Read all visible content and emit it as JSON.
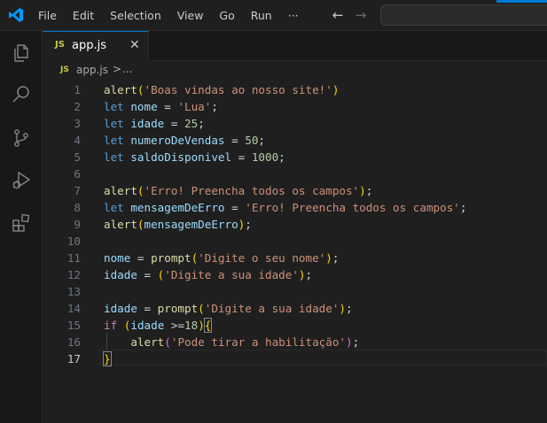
{
  "menu": [
    "File",
    "Edit",
    "Selection",
    "View",
    "Go",
    "Run",
    "···"
  ],
  "nav": {
    "back": "←",
    "forward": "→"
  },
  "activity_icons": [
    "explorer-icon",
    "search-icon",
    "source-control-icon",
    "run-debug-icon",
    "extensions-icon"
  ],
  "tab": {
    "icon": "JS",
    "name": "app.js",
    "close": "✕"
  },
  "breadcrumb": {
    "icon": "JS",
    "file": "app.js",
    "sep": ">",
    "more": "..."
  },
  "colors": {
    "accent": "#0078d4",
    "editor_bg": "#1f1f1f",
    "function": "#dcdcaa",
    "string": "#ce9178",
    "keyword": "#569cd6",
    "variable": "#9cdcfe",
    "number": "#b5cea8"
  },
  "active_line": 17,
  "lines": [
    [
      {
        "t": "fn",
        "v": "alert"
      },
      {
        "t": "br1",
        "v": "("
      },
      {
        "t": "str",
        "v": "'Boas vindas ao nosso site!'"
      },
      {
        "t": "br1",
        "v": ")"
      }
    ],
    [
      {
        "t": "kw",
        "v": "let"
      },
      {
        "t": "op",
        "v": " "
      },
      {
        "t": "var",
        "v": "nome"
      },
      {
        "t": "op",
        "v": " = "
      },
      {
        "t": "str",
        "v": "'Lua'"
      },
      {
        "t": "op",
        "v": ";"
      }
    ],
    [
      {
        "t": "kw",
        "v": "let"
      },
      {
        "t": "op",
        "v": " "
      },
      {
        "t": "var",
        "v": "idade"
      },
      {
        "t": "op",
        "v": " = "
      },
      {
        "t": "num",
        "v": "25"
      },
      {
        "t": "op",
        "v": ";"
      }
    ],
    [
      {
        "t": "kw",
        "v": "let"
      },
      {
        "t": "op",
        "v": " "
      },
      {
        "t": "var",
        "v": "numeroDeVendas"
      },
      {
        "t": "op",
        "v": " = "
      },
      {
        "t": "num",
        "v": "50"
      },
      {
        "t": "op",
        "v": ";"
      }
    ],
    [
      {
        "t": "kw",
        "v": "let"
      },
      {
        "t": "op",
        "v": " "
      },
      {
        "t": "var",
        "v": "saldoDisponivel"
      },
      {
        "t": "op",
        "v": " = "
      },
      {
        "t": "num",
        "v": "1000"
      },
      {
        "t": "op",
        "v": ";"
      }
    ],
    [],
    [
      {
        "t": "fn",
        "v": "alert"
      },
      {
        "t": "br1",
        "v": "("
      },
      {
        "t": "str",
        "v": "'Erro! Preencha todos os campos'"
      },
      {
        "t": "br1",
        "v": ")"
      },
      {
        "t": "op",
        "v": ";"
      }
    ],
    [
      {
        "t": "kw",
        "v": "let"
      },
      {
        "t": "op",
        "v": " "
      },
      {
        "t": "var",
        "v": "mensagemDeErro"
      },
      {
        "t": "op",
        "v": " = "
      },
      {
        "t": "str",
        "v": "'Erro! Preencha todos os campos'"
      },
      {
        "t": "op",
        "v": ";"
      }
    ],
    [
      {
        "t": "fn",
        "v": "alert"
      },
      {
        "t": "br1",
        "v": "("
      },
      {
        "t": "var",
        "v": "mensagemDeErro"
      },
      {
        "t": "br1",
        "v": ")"
      },
      {
        "t": "op",
        "v": ";"
      }
    ],
    [],
    [
      {
        "t": "var",
        "v": "nome"
      },
      {
        "t": "op",
        "v": " = "
      },
      {
        "t": "fn",
        "v": "prompt"
      },
      {
        "t": "br1",
        "v": "("
      },
      {
        "t": "str",
        "v": "'Digite o seu nome'"
      },
      {
        "t": "br1",
        "v": ")"
      },
      {
        "t": "op",
        "v": ";"
      }
    ],
    [
      {
        "t": "var",
        "v": "idade"
      },
      {
        "t": "op",
        "v": " = "
      },
      {
        "t": "br1",
        "v": "("
      },
      {
        "t": "str",
        "v": "'Digite a sua idade'"
      },
      {
        "t": "br1",
        "v": ")"
      },
      {
        "t": "op",
        "v": ";"
      }
    ],
    [],
    [
      {
        "t": "var",
        "v": "idade"
      },
      {
        "t": "op",
        "v": " = "
      },
      {
        "t": "fn",
        "v": "prompt"
      },
      {
        "t": "br1",
        "v": "("
      },
      {
        "t": "str",
        "v": "'Digite a sua idade'"
      },
      {
        "t": "br1",
        "v": ")"
      },
      {
        "t": "op",
        "v": ";"
      }
    ],
    [
      {
        "t": "ctl",
        "v": "if"
      },
      {
        "t": "op",
        "v": " "
      },
      {
        "t": "br1",
        "v": "("
      },
      {
        "t": "var",
        "v": "idade"
      },
      {
        "t": "op",
        "v": " >="
      },
      {
        "t": "num",
        "v": "18"
      },
      {
        "t": "br1",
        "v": ")"
      },
      {
        "t": "br1",
        "v": "{"
      }
    ],
    [
      {
        "t": "op",
        "v": "    "
      },
      {
        "t": "fn",
        "v": "alert"
      },
      {
        "t": "br2",
        "v": "("
      },
      {
        "t": "str",
        "v": "'Pode tirar a habilitação'"
      },
      {
        "t": "br2",
        "v": ")"
      },
      {
        "t": "op",
        "v": ";"
      }
    ],
    [
      {
        "t": "br1",
        "v": "}"
      }
    ]
  ]
}
